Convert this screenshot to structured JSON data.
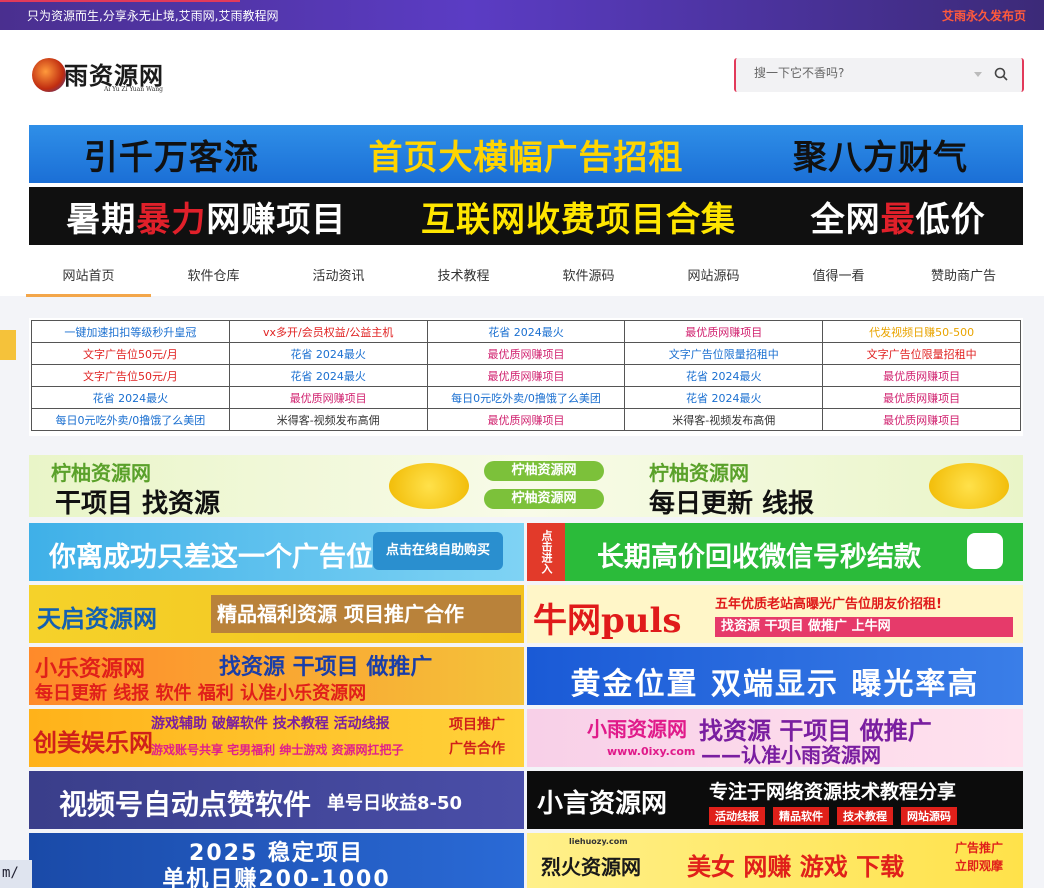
{
  "topbar": {
    "slogan": "只为资源而生,分享永无止境,艾雨网,艾雨教程网",
    "publish_link": "艾雨永久发布页",
    "load_progress": 0.23
  },
  "logo": {
    "name": "雨资源网",
    "subtitle": "Ai Yu Zi Yuan Wang"
  },
  "search": {
    "placeholder": "搜一下它不香吗?",
    "icon": "search-icon",
    "dropdown_icon": "caret-down-icon",
    "accent_color": "#e23a5a"
  },
  "banners": {
    "top": {
      "part1": "引千万客流",
      "part2": "首页大横幅广告招租",
      "part3": "聚八方财气"
    },
    "second": {
      "part1a": "暑期",
      "part1b": "暴力",
      "part1c": "网赚项目",
      "part2": "互联网收费项目合集",
      "part3a": "全网",
      "part3b": "最",
      "part3c": "低价"
    }
  },
  "nav": {
    "items": [
      "网站首页",
      "软件仓库",
      "活动资讯",
      "技术教程",
      "软件源码",
      "网站源码",
      "值得一看",
      "赞助商广告"
    ],
    "active_index": 0,
    "accent_color": "#f3a64a"
  },
  "link_table": {
    "rows": [
      [
        {
          "text": "一键加速扣扣等级秒升皇冠",
          "color": "#1a6fd0"
        },
        {
          "text": "vx多开/会员权益/公益主机",
          "color": "#e02222"
        },
        {
          "text": "花省 2024最火",
          "color": "#1a6fd0"
        },
        {
          "text": "最优质网赚项目",
          "color": "#d0206e"
        },
        {
          "text": "代发视频日赚50-500",
          "color": "#e9a400"
        }
      ],
      [
        {
          "text": "文字广告位50元/月",
          "color": "#e02222"
        },
        {
          "text": "花省 2024最火",
          "color": "#1a6fd0"
        },
        {
          "text": "最优质网赚项目",
          "color": "#d0206e"
        },
        {
          "text": "文字广告位限量招租中",
          "color": "#1a6fd0"
        },
        {
          "text": "文字广告位限量招租中",
          "color": "#e02222"
        }
      ],
      [
        {
          "text": "文字广告位50元/月",
          "color": "#e02222"
        },
        {
          "text": "花省 2024最火",
          "color": "#1a6fd0"
        },
        {
          "text": "最优质网赚项目",
          "color": "#d0206e"
        },
        {
          "text": "花省 2024最火",
          "color": "#1a6fd0"
        },
        {
          "text": "最优质网赚项目",
          "color": "#d0206e"
        }
      ],
      [
        {
          "text": "花省 2024最火",
          "color": "#1a6fd0"
        },
        {
          "text": "最优质网赚项目",
          "color": "#d0206e"
        },
        {
          "text": "每日0元吃外卖/0撸饿了么美团",
          "color": "#1a6fd0"
        },
        {
          "text": "花省 2024最火",
          "color": "#1a6fd0"
        },
        {
          "text": "最优质网赚项目",
          "color": "#d0206e"
        }
      ],
      [
        {
          "text": "每日0元吃外卖/0撸饿了么美团",
          "color": "#1a6fd0"
        },
        {
          "text": "米得客-视频发布高佣",
          "color": "#333333"
        },
        {
          "text": "最优质网赚项目",
          "color": "#d0206e"
        },
        {
          "text": "米得客-视频发布高佣",
          "color": "#333333"
        },
        {
          "text": "最优质网赚项目",
          "color": "#d0206e"
        }
      ]
    ]
  },
  "ads": {
    "lemon": {
      "brand": "柠柚资源网",
      "slogan_left": "干项目 找资源",
      "slogan_right": "每日更新 线报"
    },
    "row1": {
      "left_main": "你离成功只差这一个广告位",
      "left_button": "点击在线自助购买",
      "right_tag": "点击进入",
      "right_main": "长期高价回收微信号秒结款"
    },
    "row2": {
      "left_brand": "天启资源网",
      "left_main": "精品福利资源 项目推广合作",
      "right_brand": "牛网puls",
      "right_top": "五年优质老站高曝光广告位朋友价招租!",
      "right_bottom": "找资源 干项目 做推广 上牛网"
    },
    "row3": {
      "left_brand": "小乐资源网",
      "left_top": "找资源 干项目 做推广",
      "left_bottom": "每日更新 线报 软件 福利 认准小乐资源网",
      "right_main": "黄金位置 双端显示 曝光率高"
    },
    "row4": {
      "left_brand": "创美娱乐网",
      "left_top": "游戏辅助 破解软件 技术教程 活动线报",
      "left_bottom": "游戏账号共享 宅男福利 绅士游戏 资源网扛把子",
      "left_side": "项目推广 广告合作",
      "right_brand": "小雨资源网",
      "right_main": "找资源 干项目 做推广",
      "right_url": "www.0ixy.com",
      "right_sub": "——认准小雨资源网"
    },
    "row5": {
      "left_main": "视频号自动点赞软件",
      "left_sub": "单号日收益8-50",
      "right_brand": "小言资源网",
      "right_top": "专注于网络资源技术教程分享",
      "right_tags": [
        "活动线报",
        "精品软件",
        "技术教程",
        "网站源码"
      ]
    },
    "row6": {
      "left_top": "2025 稳定项目",
      "left_bottom": "单机日赚200-1000",
      "right_url": "liehuozy.com",
      "right_brand": "烈火资源网",
      "right_main": "美女 网赚 游戏 下载",
      "right_side": "广告推广 立即观摩"
    }
  },
  "url_fragment": "m/"
}
